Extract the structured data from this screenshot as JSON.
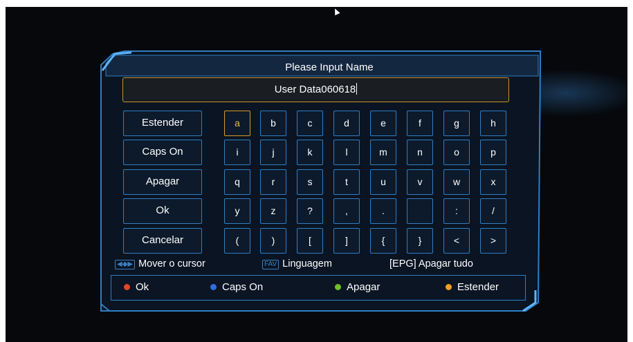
{
  "dialog": {
    "title": "Please Input Name",
    "input_value": "User Data060618"
  },
  "function_buttons": [
    "Estender",
    "Caps On",
    "Apagar",
    "Ok",
    "Cancelar"
  ],
  "keys": [
    [
      "a",
      "b",
      "c",
      "d",
      "e",
      "f",
      "g",
      "h"
    ],
    [
      "i",
      "j",
      "k",
      "l",
      "m",
      "n",
      "o",
      "p"
    ],
    [
      "q",
      "r",
      "s",
      "t",
      "u",
      "v",
      "w",
      "x"
    ],
    [
      "y",
      "z",
      "?",
      ",",
      ".",
      "",
      ":",
      "/"
    ],
    [
      "(",
      ")",
      "[",
      "]",
      "{",
      "}",
      "<",
      ">"
    ]
  ],
  "selected_key": "a",
  "hints": {
    "move_icon": "◀◆▶",
    "move_label": "Mover o cursor",
    "fav_icon": "FAV",
    "fav_label": "Linguagem",
    "epg_label": "[EPG] Apagar tudo"
  },
  "legend": [
    {
      "label": "Ok",
      "color": "#e0462a"
    },
    {
      "label": "Caps On",
      "color": "#2d6fe0"
    },
    {
      "label": "Apagar",
      "color": "#6fbf2a"
    },
    {
      "label": "Estender",
      "color": "#f0a020"
    }
  ],
  "colors": {
    "frame_blue": "#2f7fc5",
    "selected_orange": "#d99a2b",
    "background": "#06080b"
  }
}
